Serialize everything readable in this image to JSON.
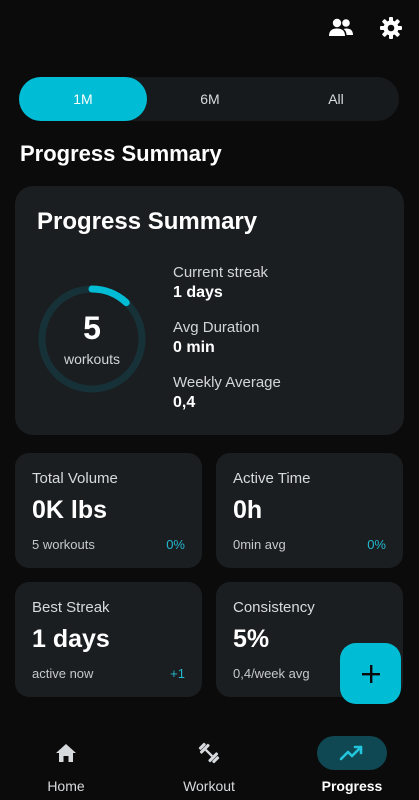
{
  "header": {
    "icons": [
      "people-icon",
      "gear-icon"
    ]
  },
  "range": {
    "tabs": [
      {
        "label": "1M",
        "active": true
      },
      {
        "label": "6M",
        "active": false
      },
      {
        "label": "All",
        "active": false
      }
    ]
  },
  "page": {
    "title": "Progress Summary"
  },
  "summary": {
    "title": "Progress Summary",
    "workouts_count": "5",
    "workouts_label": "workouts",
    "ring_progress": 0.12,
    "stats": [
      {
        "label": "Current streak",
        "value": "1 days"
      },
      {
        "label": "Avg Duration",
        "value": "0 min"
      },
      {
        "label": "Weekly Average",
        "value": "0,4"
      }
    ]
  },
  "cards": {
    "total_volume": {
      "label": "Total Volume",
      "value": "0K lbs",
      "sub": "5 workouts",
      "badge": "0%"
    },
    "active_time": {
      "label": "Active Time",
      "value": "0h",
      "sub": "0min avg",
      "badge": "0%"
    },
    "best_streak": {
      "label": "Best Streak",
      "value": "1 days",
      "sub": "active now",
      "badge": "+1"
    },
    "consistency": {
      "label": "Consistency",
      "value": "5%",
      "sub": "0,4/week avg"
    }
  },
  "fab": {
    "icon": "plus-icon"
  },
  "nav": {
    "items": [
      {
        "label": "Home",
        "icon": "home-icon",
        "active": false
      },
      {
        "label": "Workout",
        "icon": "dumbbell-icon",
        "active": false
      },
      {
        "label": "Progress",
        "icon": "trending-up-icon",
        "active": true
      }
    ]
  },
  "colors": {
    "accent": "#00bcd4",
    "background": "#0b0b0b",
    "card": "#1b1e20",
    "ring_track": "#163238",
    "nav_active_pill": "#0f4753"
  }
}
